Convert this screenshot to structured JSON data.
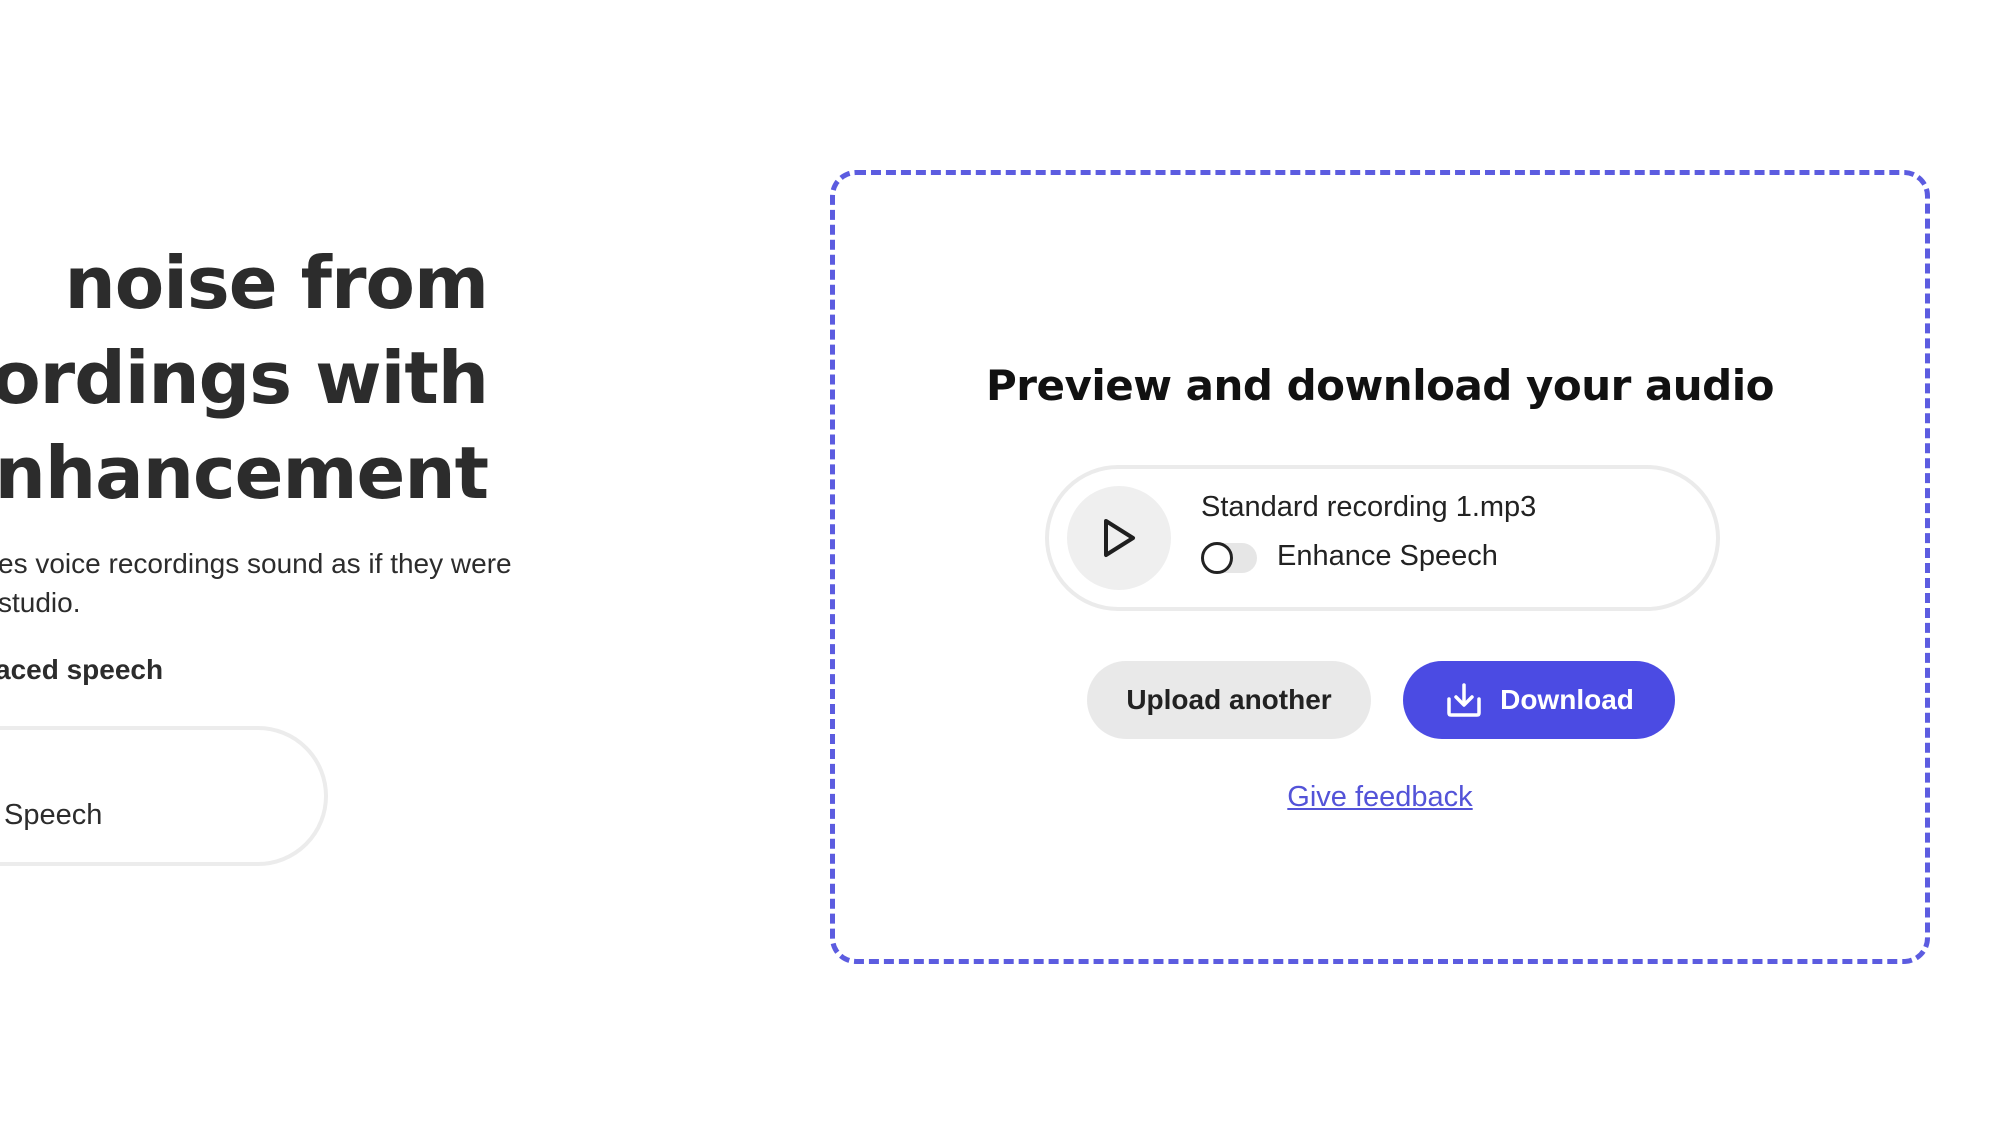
{
  "hero": {
    "title_lines": [
      "noise from",
      "ordings with",
      "nhancement"
    ],
    "description_lines": [
      "es voice recordings sound as if they were",
      "studio."
    ],
    "option_label": "aced speech",
    "pill_label": "Speech"
  },
  "dropzone": {
    "title": "Preview and download your audio",
    "border_color": "#5c5ce0",
    "player": {
      "play_icon": "play-icon",
      "filename": "Standard recording 1.mp3",
      "toggle_label": "Enhance Speech",
      "toggle_on": false
    },
    "buttons": {
      "upload_label": "Upload another",
      "download_label": "Download",
      "download_icon": "download-icon",
      "download_color": "#4b4be3"
    },
    "feedback_link": "Give feedback"
  }
}
